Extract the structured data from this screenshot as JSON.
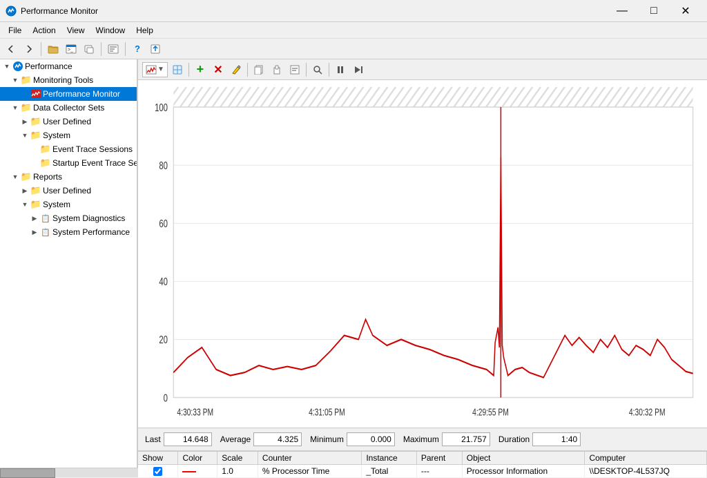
{
  "window": {
    "title": "Performance Monitor",
    "icon": "📊"
  },
  "title_bar_buttons": {
    "minimize": "—",
    "maximize": "□",
    "close": "✕"
  },
  "menu": {
    "items": [
      "File",
      "Action",
      "View",
      "Window",
      "Help"
    ]
  },
  "toolbar": {
    "buttons": [
      {
        "name": "back",
        "icon": "◀",
        "label": "Back"
      },
      {
        "name": "forward",
        "icon": "▶",
        "label": "Forward"
      },
      {
        "name": "up",
        "icon": "📁",
        "label": "Up"
      },
      {
        "name": "show-console",
        "icon": "🖥",
        "label": "Show Console"
      },
      {
        "name": "new-window",
        "icon": "⊞",
        "label": "New Window"
      },
      {
        "name": "properties",
        "icon": "📋",
        "label": "Properties"
      },
      {
        "name": "help",
        "icon": "?",
        "label": "Help"
      },
      {
        "name": "export-report",
        "icon": "📊",
        "label": "Export Report"
      }
    ]
  },
  "tree": {
    "root": "Performance",
    "items": [
      {
        "id": "monitoring-tools",
        "label": "Monitoring Tools",
        "level": 1,
        "expanded": true,
        "icon": "folder"
      },
      {
        "id": "performance-monitor",
        "label": "Performance Monitor",
        "level": 2,
        "selected": true,
        "icon": "chart"
      },
      {
        "id": "data-collector-sets",
        "label": "Data Collector Sets",
        "level": 1,
        "expanded": true,
        "icon": "folder"
      },
      {
        "id": "user-defined-1",
        "label": "User Defined",
        "level": 2,
        "icon": "folder"
      },
      {
        "id": "system-1",
        "label": "System",
        "level": 2,
        "icon": "folder",
        "expanded": true
      },
      {
        "id": "event-trace-sessions",
        "label": "Event Trace Sessions",
        "level": 3,
        "icon": "folder"
      },
      {
        "id": "startup-event-trace",
        "label": "Startup Event Trace Sess...",
        "level": 3,
        "icon": "folder"
      },
      {
        "id": "reports",
        "label": "Reports",
        "level": 1,
        "expanded": true,
        "icon": "folder"
      },
      {
        "id": "user-defined-2",
        "label": "User Defined",
        "level": 2,
        "icon": "folder"
      },
      {
        "id": "system-2",
        "label": "System",
        "level": 2,
        "icon": "folder",
        "expanded": true
      },
      {
        "id": "system-diagnostics",
        "label": "System Diagnostics",
        "level": 3,
        "icon": "report"
      },
      {
        "id": "system-performance",
        "label": "System Performance",
        "level": 3,
        "icon": "report"
      }
    ]
  },
  "chart_toolbar": {
    "view_label": "📈",
    "buttons": [
      {
        "name": "view-type",
        "icon": "📉",
        "label": "View Type"
      },
      {
        "name": "freeze",
        "icon": "❄",
        "label": "Freeze"
      },
      {
        "name": "add-counter",
        "icon": "+",
        "label": "Add Counter",
        "color": "green"
      },
      {
        "name": "delete",
        "icon": "✕",
        "label": "Delete",
        "color": "red"
      },
      {
        "name": "highlight",
        "icon": "✎",
        "label": "Highlight"
      },
      {
        "name": "copy",
        "icon": "📋",
        "label": "Copy Properties"
      },
      {
        "name": "paste",
        "icon": "📄",
        "label": "Paste Counter"
      },
      {
        "name": "properties2",
        "icon": "🗒",
        "label": "Properties"
      },
      {
        "name": "zoom",
        "icon": "🔍",
        "label": "Zoom"
      },
      {
        "name": "pause",
        "icon": "⏸",
        "label": "Pause"
      },
      {
        "name": "next",
        "icon": "⏭",
        "label": "Next Frame"
      }
    ]
  },
  "chart": {
    "y_max": 100,
    "y_labels": [
      "100",
      "80",
      "60",
      "40",
      "20",
      "0"
    ],
    "x_labels": [
      "4:30:33 PM",
      "4:31:05 PM",
      "4:29:55 PM",
      "4:30:32 PM"
    ],
    "line_color": "#cc0000",
    "cursor_color": "#cc0000"
  },
  "stats": {
    "last_label": "Last",
    "last_value": "14.648",
    "average_label": "Average",
    "average_value": "4.325",
    "minimum_label": "Minimum",
    "minimum_value": "0.000",
    "maximum_label": "Maximum",
    "maximum_value": "21.757",
    "duration_label": "Duration",
    "duration_value": "1:40"
  },
  "counter_table": {
    "headers": [
      "Show",
      "Color",
      "Scale",
      "Counter",
      "Instance",
      "Parent",
      "Object",
      "Computer"
    ],
    "rows": [
      {
        "show": true,
        "color": "red",
        "scale": "1.0",
        "counter": "% Processor Time",
        "instance": "_Total",
        "parent": "---",
        "object": "Processor Information",
        "computer": "\\\\DESKTOP-4L537JQ"
      }
    ]
  }
}
